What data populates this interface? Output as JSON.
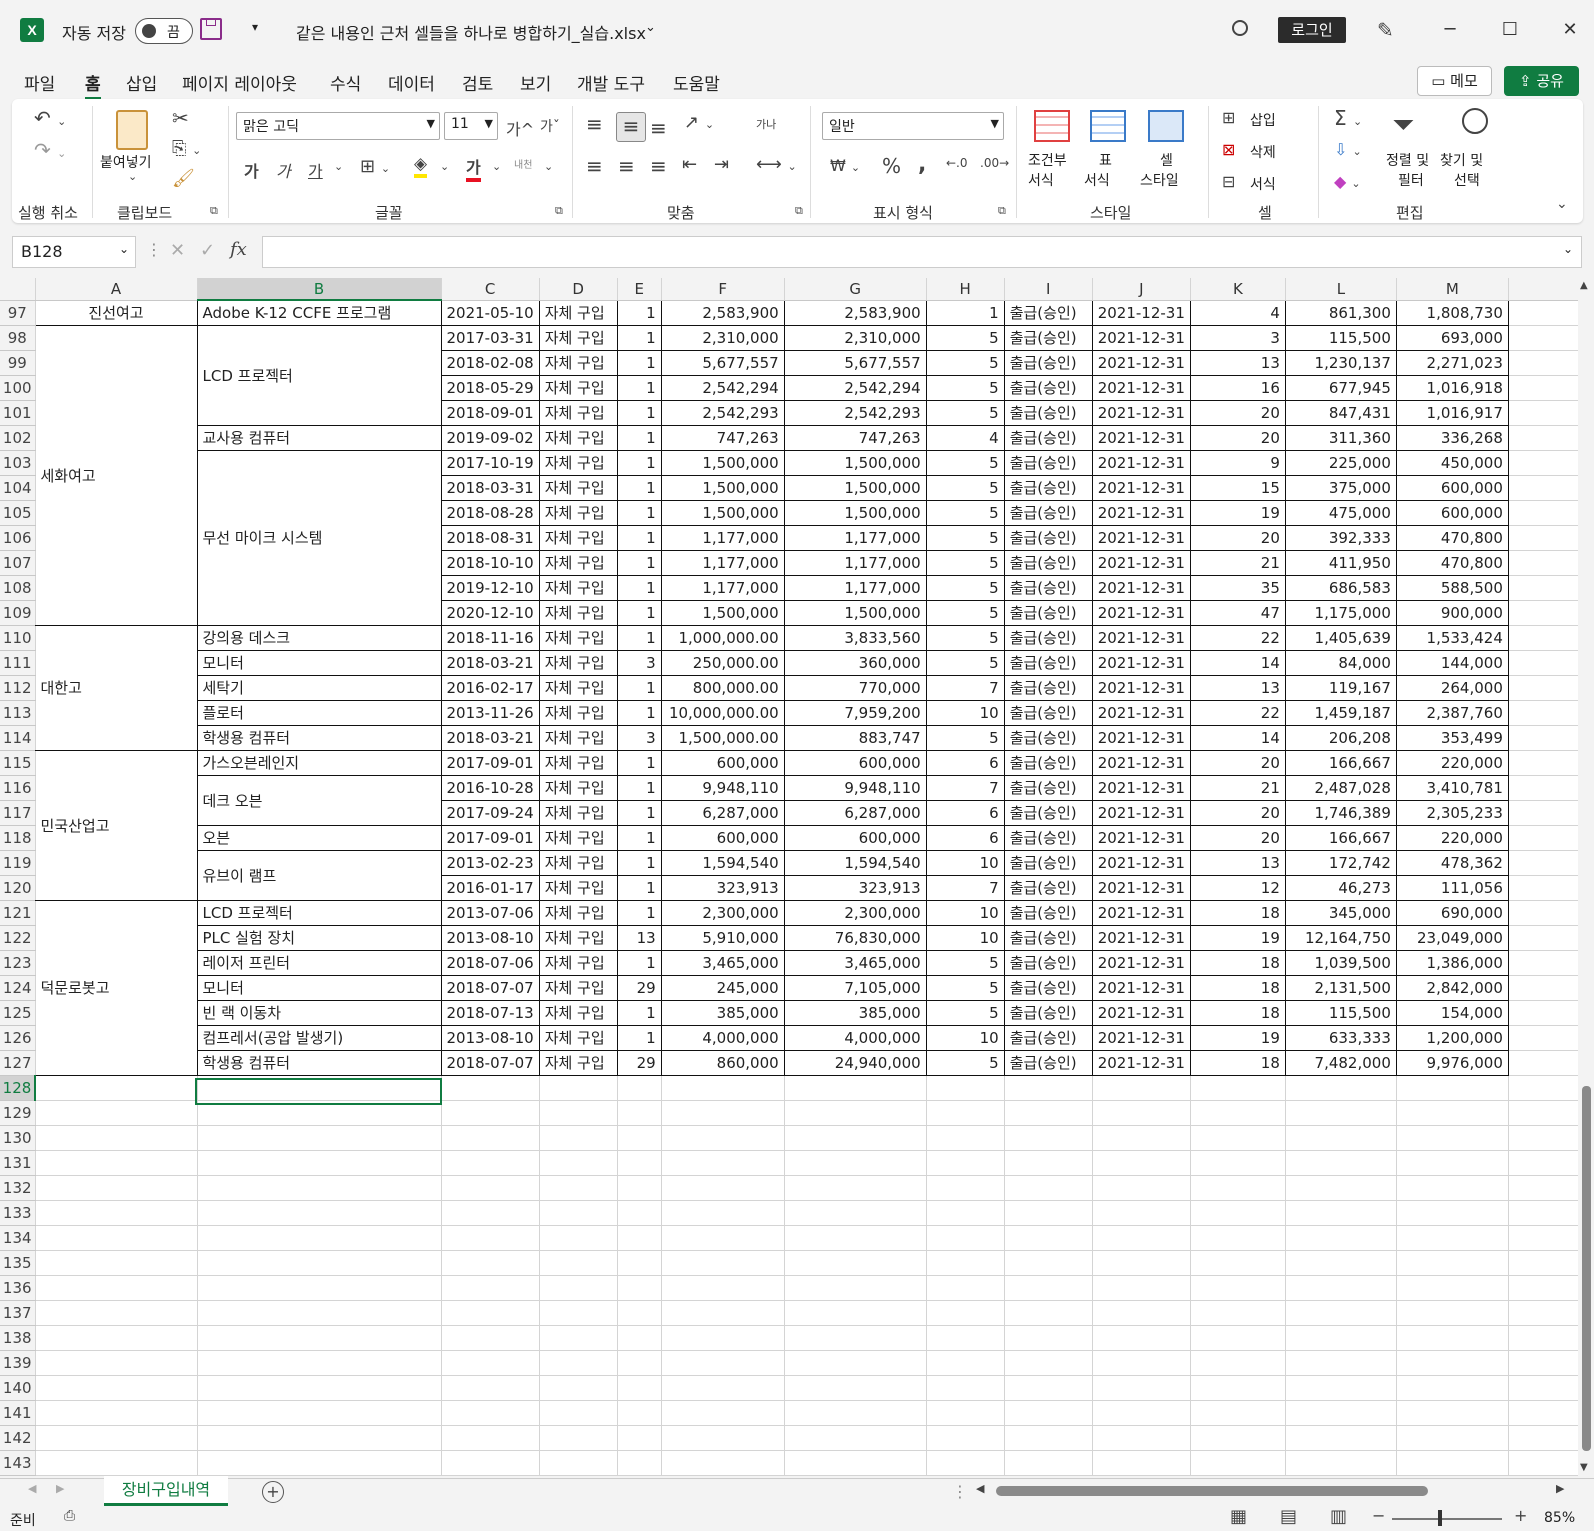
{
  "app": {
    "autosave_label": "자동 저장",
    "autosave_state": "끔",
    "filename": "같은 내용인 근처 셀들을 하나로 병합하기_실습.xlsx",
    "signin": "로그인"
  },
  "ribbon_tabs": [
    "파일",
    "홈",
    "삽입",
    "페이지 레이아웃",
    "수식",
    "데이터",
    "검토",
    "보기",
    "개발 도구",
    "도움말"
  ],
  "memo": "메모",
  "share": "공유",
  "groups": {
    "undo": "실행 취소",
    "clipboard": "클립보드",
    "font": "글꼴",
    "align": "맞춤",
    "number": "표시 형식",
    "style": "스타일",
    "cells": "셀",
    "edit": "편집"
  },
  "ribbon": {
    "paste": "붙여넣기",
    "font_name": "맑은 고딕",
    "font_size": "11",
    "number_format": "일반",
    "cond_format_1": "조건부",
    "cond_format_2": "서식",
    "table_1": "표",
    "table_2": "서식",
    "cell_style_1": "셀",
    "cell_style_2": "스타일",
    "insert": "삽입",
    "delete": "삭제",
    "format": "서식",
    "sort_1": "정렬 및",
    "sort_2": "필터",
    "find_1": "찾기 및",
    "find_2": "선택",
    "grow": "가^",
    "shrink": "가ˇ",
    "bold": "가",
    "italic": "가",
    "underline": "가",
    "font_color": "가",
    "wrap": "가나",
    "phonetic": "내천"
  },
  "namebox": "B128",
  "columns": [
    "A",
    "B",
    "C",
    "D",
    "E",
    "F",
    "G",
    "H",
    "I",
    "J",
    "K",
    "L",
    "M"
  ],
  "rows": [
    [
      "97",
      "진선여고",
      "Adobe K-12 CCFE 프로그램",
      "2021-05-10",
      "자체 구입",
      "1",
      "2,583,900",
      "2,583,900",
      "1",
      "출급(승인)",
      "2021-12-31",
      "4",
      "861,300",
      "1,808,730"
    ],
    [
      "98",
      "",
      "",
      "2017-03-31",
      "자체 구입",
      "1",
      "2,310,000",
      "2,310,000",
      "5",
      "출급(승인)",
      "2021-12-31",
      "3",
      "115,500",
      "693,000"
    ],
    [
      "99",
      "",
      "LCD 프로젝터",
      "2018-02-08",
      "자체 구입",
      "1",
      "5,677,557",
      "5,677,557",
      "5",
      "출급(승인)",
      "2021-12-31",
      "13",
      "1,230,137",
      "2,271,023"
    ],
    [
      "100",
      "",
      "",
      "2018-05-29",
      "자체 구입",
      "1",
      "2,542,294",
      "2,542,294",
      "5",
      "출급(승인)",
      "2021-12-31",
      "16",
      "677,945",
      "1,016,918"
    ],
    [
      "101",
      "",
      "",
      "2018-09-01",
      "자체 구입",
      "1",
      "2,542,293",
      "2,542,293",
      "5",
      "출급(승인)",
      "2021-12-31",
      "20",
      "847,431",
      "1,016,917"
    ],
    [
      "102",
      "",
      "교사용 컴퓨터",
      "2019-09-02",
      "자체 구입",
      "1",
      "747,263",
      "747,263",
      "4",
      "출급(승인)",
      "2021-12-31",
      "20",
      "311,360",
      "336,268"
    ],
    [
      "103",
      "세화여고",
      "",
      "2017-10-19",
      "자체 구입",
      "1",
      "1,500,000",
      "1,500,000",
      "5",
      "출급(승인)",
      "2021-12-31",
      "9",
      "225,000",
      "450,000"
    ],
    [
      "104",
      "",
      "",
      "2018-03-31",
      "자체 구입",
      "1",
      "1,500,000",
      "1,500,000",
      "5",
      "출급(승인)",
      "2021-12-31",
      "15",
      "375,000",
      "600,000"
    ],
    [
      "105",
      "",
      "",
      "2018-08-28",
      "자체 구입",
      "1",
      "1,500,000",
      "1,500,000",
      "5",
      "출급(승인)",
      "2021-12-31",
      "19",
      "475,000",
      "600,000"
    ],
    [
      "106",
      "",
      "무선 마이크 시스템",
      "2018-08-31",
      "자체 구입",
      "1",
      "1,177,000",
      "1,177,000",
      "5",
      "출급(승인)",
      "2021-12-31",
      "20",
      "392,333",
      "470,800"
    ],
    [
      "107",
      "",
      "",
      "2018-10-10",
      "자체 구입",
      "1",
      "1,177,000",
      "1,177,000",
      "5",
      "출급(승인)",
      "2021-12-31",
      "21",
      "411,950",
      "470,800"
    ],
    [
      "108",
      "",
      "",
      "2019-12-10",
      "자체 구입",
      "1",
      "1,177,000",
      "1,177,000",
      "5",
      "출급(승인)",
      "2021-12-31",
      "35",
      "686,583",
      "588,500"
    ],
    [
      "109",
      "",
      "",
      "2020-12-10",
      "자체 구입",
      "1",
      "1,500,000",
      "1,500,000",
      "5",
      "출급(승인)",
      "2021-12-31",
      "47",
      "1,175,000",
      "900,000"
    ],
    [
      "110",
      "",
      "강의용 데스크",
      "2018-11-16",
      "자체 구입",
      "1",
      "1,000,000.00",
      "3,833,560",
      "5",
      "출급(승인)",
      "2021-12-31",
      "22",
      "1,405,639",
      "1,533,424"
    ],
    [
      "111",
      "",
      "모니터",
      "2018-03-21",
      "자체 구입",
      "3",
      "250,000.00",
      "360,000",
      "5",
      "출급(승인)",
      "2021-12-31",
      "14",
      "84,000",
      "144,000"
    ],
    [
      "112",
      "대한고",
      "세탁기",
      "2016-02-17",
      "자체 구입",
      "1",
      "800,000.00",
      "770,000",
      "7",
      "출급(승인)",
      "2021-12-31",
      "13",
      "119,167",
      "264,000"
    ],
    [
      "113",
      "",
      "플로터",
      "2013-11-26",
      "자체 구입",
      "1",
      "10,000,000.00",
      "7,959,200",
      "10",
      "출급(승인)",
      "2021-12-31",
      "22",
      "1,459,187",
      "2,387,760"
    ],
    [
      "114",
      "",
      "학생용 컴퓨터",
      "2018-03-21",
      "자체 구입",
      "3",
      "1,500,000.00",
      "883,747",
      "5",
      "출급(승인)",
      "2021-12-31",
      "14",
      "206,208",
      "353,499"
    ],
    [
      "115",
      "",
      "가스오븐레인지",
      "2017-09-01",
      "자체 구입",
      "1",
      "600,000",
      "600,000",
      "6",
      "출급(승인)",
      "2021-12-31",
      "20",
      "166,667",
      "220,000"
    ],
    [
      "116",
      "",
      "데크 오븐",
      "2016-10-28",
      "자체 구입",
      "1",
      "9,948,110",
      "9,948,110",
      "7",
      "출급(승인)",
      "2021-12-31",
      "21",
      "2,487,028",
      "3,410,781"
    ],
    [
      "117",
      "민국산업고",
      "",
      "2017-09-24",
      "자체 구입",
      "1",
      "6,287,000",
      "6,287,000",
      "6",
      "출급(승인)",
      "2021-12-31",
      "20",
      "1,746,389",
      "2,305,233"
    ],
    [
      "118",
      "",
      "오븐",
      "2017-09-01",
      "자체 구입",
      "1",
      "600,000",
      "600,000",
      "6",
      "출급(승인)",
      "2021-12-31",
      "20",
      "166,667",
      "220,000"
    ],
    [
      "119",
      "",
      "유브이 램프",
      "2013-02-23",
      "자체 구입",
      "1",
      "1,594,540",
      "1,594,540",
      "10",
      "출급(승인)",
      "2021-12-31",
      "13",
      "172,742",
      "478,362"
    ],
    [
      "120",
      "",
      "",
      "2016-01-17",
      "자체 구입",
      "1",
      "323,913",
      "323,913",
      "7",
      "출급(승인)",
      "2021-12-31",
      "12",
      "46,273",
      "111,056"
    ],
    [
      "121",
      "",
      "LCD 프로젝터",
      "2013-07-06",
      "자체 구입",
      "1",
      "2,300,000",
      "2,300,000",
      "10",
      "출급(승인)",
      "2021-12-31",
      "18",
      "345,000",
      "690,000"
    ],
    [
      "122",
      "",
      "PLC 실험 장치",
      "2013-08-10",
      "자체 구입",
      "13",
      "5,910,000",
      "76,830,000",
      "10",
      "출급(승인)",
      "2021-12-31",
      "19",
      "12,164,750",
      "23,049,000"
    ],
    [
      "123",
      "",
      "레이저 프린터",
      "2018-07-06",
      "자체 구입",
      "1",
      "3,465,000",
      "3,465,000",
      "5",
      "출급(승인)",
      "2021-12-31",
      "18",
      "1,039,500",
      "1,386,000"
    ],
    [
      "124",
      "덕문로봇고",
      "모니터",
      "2018-07-07",
      "자체 구입",
      "29",
      "245,000",
      "7,105,000",
      "5",
      "출급(승인)",
      "2021-12-31",
      "18",
      "2,131,500",
      "2,842,000"
    ],
    [
      "125",
      "",
      "빈 랙 이동차",
      "2018-07-13",
      "자체 구입",
      "1",
      "385,000",
      "385,000",
      "5",
      "출급(승인)",
      "2021-12-31",
      "18",
      "115,500",
      "154,000"
    ],
    [
      "126",
      "",
      "컴프레서(공압 발생기)",
      "2013-08-10",
      "자체 구입",
      "1",
      "4,000,000",
      "4,000,000",
      "10",
      "출급(승인)",
      "2021-12-31",
      "19",
      "633,333",
      "1,200,000"
    ],
    [
      "127",
      "",
      "학생용 컴퓨터",
      "2018-07-07",
      "자체 구입",
      "29",
      "860,000",
      "24,940,000",
      "5",
      "출급(승인)",
      "2021-12-31",
      "18",
      "7,482,000",
      "9,976,000"
    ]
  ],
  "empty_rows": [
    "128",
    "129",
    "130",
    "131",
    "132",
    "133",
    "134",
    "135",
    "136",
    "137",
    "138",
    "139",
    "140",
    "141",
    "142",
    "143"
  ],
  "sheet_tab": "장비구입내역",
  "status": {
    "ready": "준비",
    "zoom": "85%"
  },
  "colors": {
    "accent": "#107c41"
  }
}
